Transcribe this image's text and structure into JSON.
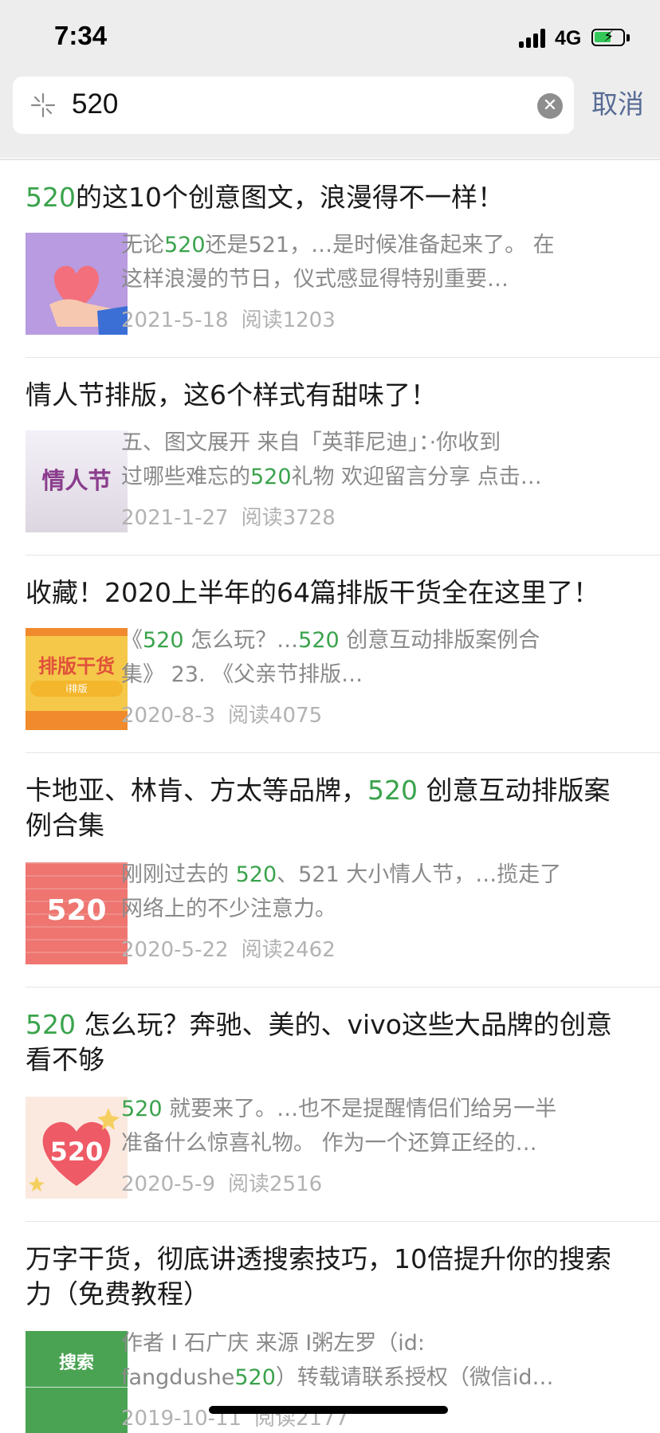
{
  "status": {
    "time": "7:34",
    "network": "4G",
    "battery_level": 0.45
  },
  "search": {
    "query": "520",
    "cancel_label": "取消"
  },
  "colors": {
    "accent": "#3aa34c",
    "link": "#576b95"
  },
  "results": [
    {
      "title_parts": [
        "",
        "520",
        "的这10个创意图文，浪漫得不一样！"
      ],
      "snippet1": [
        "无论",
        "520",
        "还是521，…是时候准备起来了。 在"
      ],
      "snippet2": [
        "这样浪漫的节日，仪式感显得特别重要…",
        "",
        ""
      ],
      "date": "2021-5-18",
      "reads": "阅读1203",
      "thumb_icon": "heart-hand-thumbnail"
    },
    {
      "title_parts": [
        "情人节排版，这6个样式有甜味了！",
        "",
        ""
      ],
      "snippet1": [
        "五、图文展开 来自「英菲尼迪」：·你收到",
        "",
        ""
      ],
      "snippet2": [
        "过哪些难忘的",
        "520",
        "礼物 欢迎留言分享 点击…"
      ],
      "date": "2021-1-27",
      "reads": "阅读3728",
      "thumb_text": "情人节"
    },
    {
      "title_parts": [
        "收藏！2020上半年的64篇排版干货全在这里了！",
        "",
        ""
      ],
      "snippet1": [
        "《",
        "520",
        " 怎么玩？…",
        "520",
        " 创意互动排版案例合"
      ],
      "snippet2": [
        "集》 23. 《父亲节排版…",
        "",
        ""
      ],
      "date": "2020-8-3",
      "reads": "阅读4075",
      "thumb_text": "排版干货",
      "thumb_sub": "i排版"
    },
    {
      "title_parts": [
        "卡地亚、林肯、方太等品牌，",
        "520",
        " 创意互动排版案"
      ],
      "title_line2": "例合集",
      "snippet1": [
        "刚刚过去的 ",
        "520",
        "、521 大小情人节，…揽走了"
      ],
      "snippet2": [
        "网络上的不少注意力。",
        "",
        ""
      ],
      "date": "2020-5-22",
      "reads": "阅读2462",
      "thumb_text": "520"
    },
    {
      "title_parts": [
        "",
        "520",
        " 怎么玩？奔驰、美的、vivo这些大品牌的创意"
      ],
      "title_line2": "看不够",
      "snippet1": [
        "",
        "520",
        " 就要来了。…也不是提醒情侣们给另一半"
      ],
      "snippet2": [
        "准备什么惊喜礼物。 作为一个还算正经的…",
        "",
        ""
      ],
      "date": "2020-5-9",
      "reads": "阅读2516",
      "thumb_text": "520"
    },
    {
      "title_parts": [
        "万字干货，彻底讲透搜索技巧，10倍提升你的搜索",
        "",
        ""
      ],
      "title_line2": "力（免费教程）",
      "snippet1": [
        "作者 I 石广庆 来源 I粥左罗（id:",
        "",
        ""
      ],
      "snippet2": [
        "fangdushe",
        "520",
        "）转载请联系授权（微信id…"
      ],
      "date": "2019-10-11",
      "reads": "阅读2177",
      "thumb_text": "搜索"
    }
  ]
}
